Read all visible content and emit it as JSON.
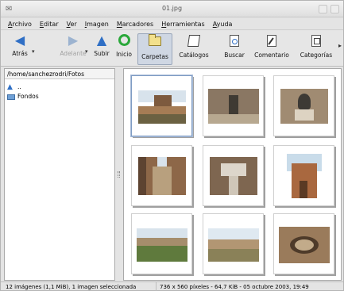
{
  "window": {
    "title": "01.jpg"
  },
  "menu": [
    "Archivo",
    "Editar",
    "Ver",
    "Imagen",
    "Marcadores",
    "Herramientas",
    "Ayuda"
  ],
  "toolbar": {
    "back": "Atrás",
    "forward": "Adelante",
    "up": "Subir",
    "home": "Inicio",
    "folders": "Carpetas",
    "catalogs": "Catálogos",
    "search": "Buscar",
    "comment": "Comentario",
    "categories": "Categorías"
  },
  "left_panel": {
    "path": "/home/sanchezrodri/Fotos",
    "items": [
      "..",
      "Fondos"
    ]
  },
  "thumbnails": [
    "castle-wall",
    "stone-arch",
    "stone-bust",
    "narrow-passage",
    "column-capital",
    "square-tower",
    "garden-walls",
    "fort-view",
    "ruined-circle"
  ],
  "status": {
    "left": "12 imágenes (1,1 MiB), 1 imagen seleccionada",
    "right": "736 x 560 píxeles - 64,7 KiB - 05 octubre 2003, 19:49"
  }
}
